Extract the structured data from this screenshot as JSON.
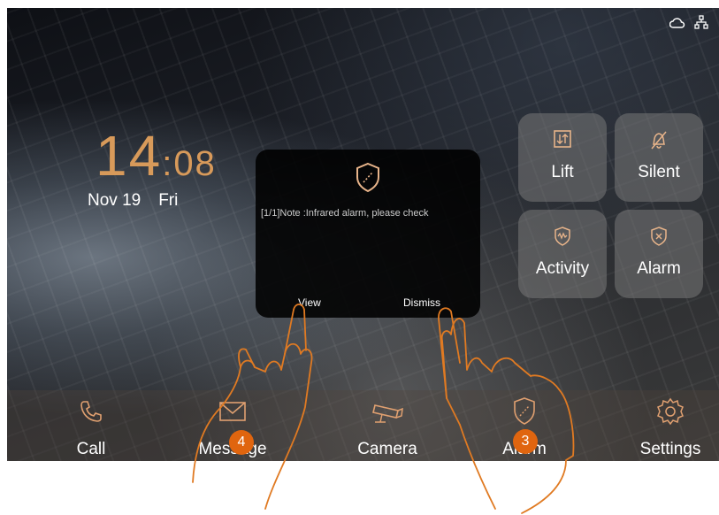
{
  "status": {
    "cloud_icon": "cloud-icon",
    "network_icon": "network-icon"
  },
  "clock": {
    "hours": "14",
    "separator": ":",
    "minutes": "08"
  },
  "date": {
    "day": "Nov 19",
    "weekday": "Fri"
  },
  "tiles": [
    {
      "label": "Lift",
      "icon": "lift-icon"
    },
    {
      "label": "Silent",
      "icon": "bell-off-icon"
    },
    {
      "label": "Activity",
      "icon": "shield-activity-icon"
    },
    {
      "label": "Alarm",
      "icon": "shield-x-icon"
    }
  ],
  "dialog": {
    "icon": "shield-icon",
    "message": "[1/1]Note :Infrared alarm, please check",
    "view_label": "View",
    "dismiss_label": "Dismiss"
  },
  "nav": [
    {
      "label": "Call",
      "icon": "phone-icon"
    },
    {
      "label": "Message",
      "icon": "envelope-icon"
    },
    {
      "label": "Camera",
      "icon": "camera-icon"
    },
    {
      "label": "Alarm",
      "icon": "shield-icon"
    },
    {
      "label": "Settings",
      "icon": "gear-icon"
    }
  ],
  "badges": {
    "view_step": "4",
    "dismiss_step": "3"
  },
  "colors": {
    "accent": "#e0a070",
    "badge": "#e0650f",
    "clock": "#d89a5a"
  }
}
